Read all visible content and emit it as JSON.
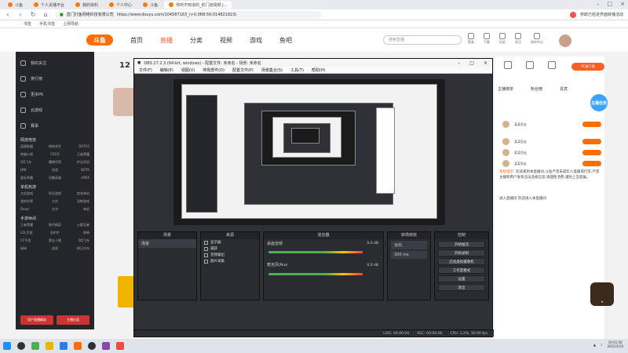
{
  "browser": {
    "tabs": [
      {
        "label": "斗鱼"
      },
      {
        "label": "个人关播平台"
      },
      {
        "label": "我的资料"
      },
      {
        "label": "个人中心"
      },
      {
        "label": "斗鱼"
      },
      {
        "label": "你所不知道的_的门道视频 J..."
      }
    ],
    "url": "https://www.douyu.com/104587163_(+0.068:50:014821823)",
    "url_prefix": "直门打鱼网络科技有限公司",
    "search_hint": "奈斯已经进界面转播活动",
    "bookmarks": [
      "书签",
      "手机书签",
      "上网导航"
    ]
  },
  "douyu": {
    "logo": "斗鱼",
    "nav": [
      "首页",
      "直播",
      "分类",
      "视频",
      "游戏",
      "鱼吧"
    ],
    "nav_active_index": 1,
    "search_placeholder": "搜索直播",
    "top_icons": [
      "登录",
      "下载",
      "历史",
      "关注",
      "创作中心"
    ],
    "live_count": "12",
    "pc_badge": "PC端下载",
    "right_tabs": [
      "主播榜单",
      "粉丝榜",
      "贵宾"
    ],
    "mission": "主播任务",
    "ranks": [
      {
        "name": "某某鱼友"
      },
      {
        "name": "某某鱼友"
      },
      {
        "name": "某某鱼友"
      },
      {
        "name": "某某鱼友"
      }
    ],
    "chat_nick": "系统提示:",
    "chat_text": "欢迎来到本直播间,斗鱼严禁未成年人直播或打赏,严禁主播和用户发布违法违规信息,请理性消费,谨防上当受骗。",
    "chat_foot": "进入直播间 欢迎进入本直播间"
  },
  "sidebar": {
    "items": [
      "我的关注",
      "排行榜",
      "更多PK",
      "云游戏",
      "赛事"
    ],
    "sections": [
      {
        "title": "网游竞技",
        "cells": [
          "英雄联盟",
          "绝地求生",
          "DOTA2",
          "穿越火线",
          "CSGO",
          "王者荣耀",
          "QQ飞车",
          "魔兽世界",
          "炉石传说",
          "DNF",
          "逆战",
          "DOTA",
          "星际争霸",
          "风暴英雄",
          "APEX"
        ]
      },
      {
        "title": "单机热游",
        "cells": [
          "主机游戏",
          "怀旧游戏",
          "综合单机",
          "我的世界",
          "方舟",
          "恐怖游戏",
          "Dead",
          "文字",
          "单机"
        ]
      },
      {
        "title": "手游休闲",
        "cells": [
          "王者荣耀",
          "和平精英",
          "火影忍者",
          "LOL手游",
          "金铲铲",
          "原神",
          "CF手游",
          "第五人格",
          "QQ飞车",
          "球球",
          "战双",
          "明日方舟"
        ]
      }
    ],
    "btn_left": "用户直播精选",
    "btn_right": "主播分类"
  },
  "obs": {
    "title": "OBS 27.2.3 (64-bit, windows) - 配置文件: 未命名 - 场景: 未命名",
    "menu": [
      "文件(F)",
      "编辑(E)",
      "视图(V)",
      "停靠部件(D)",
      "配置文件(P)",
      "场景集合(S)",
      "工具(T)",
      "帮助(H)"
    ],
    "docks": {
      "scenes": "场景",
      "sources": "来源",
      "mixer": "混音器",
      "transitions": "转场特效",
      "controls": "控制"
    },
    "scene_item": "场景",
    "scene_label": "未选择来源",
    "sources": [
      "显示器",
      "捕获",
      "音频输出",
      "图片采集"
    ],
    "mixer_tracks": [
      {
        "name": "桌面音频",
        "db": "0.0 dB"
      },
      {
        "name": "麦克风/Aux",
        "db": "0.0 dB"
      }
    ],
    "transition_name": "淡出",
    "transition_duration": "300 ms",
    "controls": [
      "开始推流",
      "开始录制",
      "启动虚拟摄像机",
      "工作室模式",
      "设置",
      "退出"
    ],
    "status": [
      "LIVE: 00:00:00",
      "REC: 00:00:00",
      "CPU: 3.2%, 30.00 fps"
    ]
  },
  "taskbar": {
    "time": "19:01:56",
    "date": "2022/3/10"
  },
  "colors": {
    "douyu_orange": "#ff6d00",
    "obs_bg": "#2f3136",
    "sidebar_bg": "#25262b"
  }
}
